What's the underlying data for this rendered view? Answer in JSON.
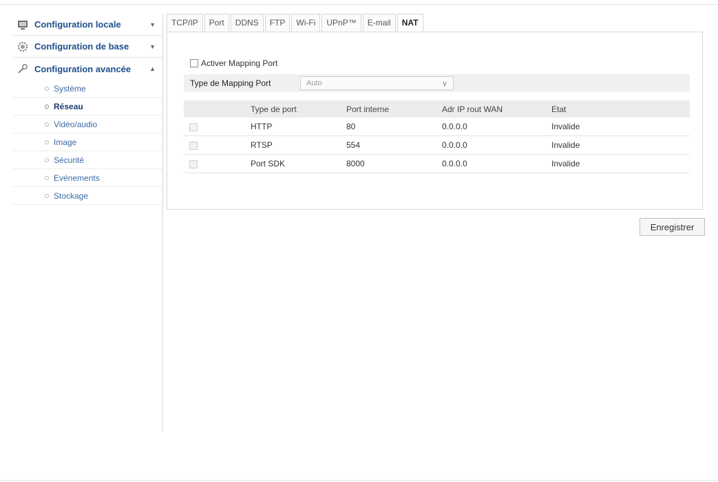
{
  "sidebar": {
    "sections": [
      {
        "label": "Configuration locale",
        "icon": "local-config-icon"
      },
      {
        "label": "Configuration de base",
        "icon": "gear-icon"
      },
      {
        "label": "Configuration avancée",
        "icon": "wrench-icon"
      }
    ],
    "sub_items": [
      {
        "label": "Système"
      },
      {
        "label": "Réseau"
      },
      {
        "label": "Vidéo/audio"
      },
      {
        "label": "Image"
      },
      {
        "label": "Sécurité"
      },
      {
        "label": "Evénements"
      },
      {
        "label": "Stockage"
      }
    ],
    "active_sub": "Réseau"
  },
  "tabs": [
    {
      "label": "TCP/IP"
    },
    {
      "label": "Port"
    },
    {
      "label": "DDNS"
    },
    {
      "label": "FTP"
    },
    {
      "label": "Wi-Fi"
    },
    {
      "label": "UPnP™"
    },
    {
      "label": "E-mail"
    },
    {
      "label": "NAT"
    }
  ],
  "active_tab": "NAT",
  "nat": {
    "enable_label": "Activer Mapping Port",
    "enable_checked": false,
    "mapping_type_label": "Type de Mapping Port",
    "mapping_type_value": "Auto",
    "table": {
      "headers": [
        "",
        "Type de port",
        "Port interne",
        "Adr IP rout WAN",
        "Etat"
      ],
      "rows": [
        {
          "type": "HTTP",
          "port": "80",
          "wan_ip": "0.0.0.0",
          "state": "Invalide"
        },
        {
          "type": "RTSP",
          "port": "554",
          "wan_ip": "0.0.0.0",
          "state": "Invalide"
        },
        {
          "type": "Port SDK",
          "port": "8000",
          "wan_ip": "0.0.0.0",
          "state": "Invalide"
        }
      ]
    }
  },
  "save_label": "Enregistrer",
  "colors": {
    "link": "#1d4f8c",
    "sub_link": "#3a6aa3",
    "border": "#d6d6d6"
  }
}
